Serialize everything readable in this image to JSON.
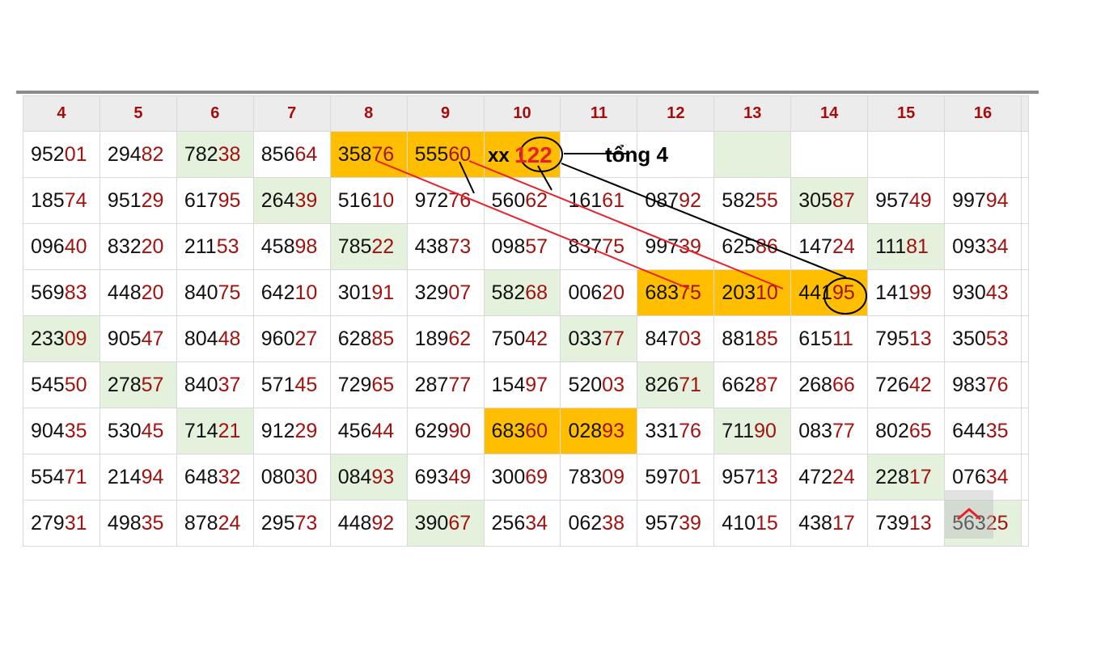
{
  "headers": [
    "4",
    "5",
    "6",
    "7",
    "8",
    "9",
    "10",
    "11",
    "12",
    "13",
    "14",
    "15",
    "16"
  ],
  "rows": [
    [
      {
        "v": "95201"
      },
      {
        "v": "29482"
      },
      {
        "v": "78238",
        "h": "g"
      },
      {
        "v": "85664"
      },
      {
        "v": "35876",
        "h": "o"
      },
      {
        "v": "55560",
        "h": "o"
      },
      {
        "v": "",
        "h": "o"
      },
      {
        "v": ""
      },
      {
        "v": ""
      },
      {
        "v": "",
        "h": "g"
      },
      {
        "v": ""
      },
      {
        "v": ""
      },
      {
        "v": ""
      }
    ],
    [
      {
        "v": "18574"
      },
      {
        "v": "95129"
      },
      {
        "v": "61795"
      },
      {
        "v": "26439",
        "h": "g"
      },
      {
        "v": "51610"
      },
      {
        "v": "97276"
      },
      {
        "v": "56062"
      },
      {
        "v": "16161"
      },
      {
        "v": "08792"
      },
      {
        "v": "58255"
      },
      {
        "v": "30587",
        "h": "g"
      },
      {
        "v": "95749"
      },
      {
        "v": "99794"
      }
    ],
    [
      {
        "v": "09640"
      },
      {
        "v": "83220"
      },
      {
        "v": "21153"
      },
      {
        "v": "45898"
      },
      {
        "v": "78522",
        "h": "g"
      },
      {
        "v": "43873"
      },
      {
        "v": "09857"
      },
      {
        "v": "83775"
      },
      {
        "v": "99739"
      },
      {
        "v": "62586"
      },
      {
        "v": "14724"
      },
      {
        "v": "11181",
        "h": "g"
      },
      {
        "v": "09334"
      }
    ],
    [
      {
        "v": "56983"
      },
      {
        "v": "44820"
      },
      {
        "v": "84075"
      },
      {
        "v": "64210"
      },
      {
        "v": "30191"
      },
      {
        "v": "32907"
      },
      {
        "v": "58268",
        "h": "g"
      },
      {
        "v": "00620"
      },
      {
        "v": "68375",
        "h": "o"
      },
      {
        "v": "20310",
        "h": "o"
      },
      {
        "v": "44195",
        "h": "o"
      },
      {
        "v": "14199"
      },
      {
        "v": "93043"
      }
    ],
    [
      {
        "v": "23309",
        "h": "g"
      },
      {
        "v": "90547"
      },
      {
        "v": "80448"
      },
      {
        "v": "96027"
      },
      {
        "v": "62885"
      },
      {
        "v": "18962"
      },
      {
        "v": "75042"
      },
      {
        "v": "03377",
        "h": "g"
      },
      {
        "v": "84703"
      },
      {
        "v": "88185"
      },
      {
        "v": "61511"
      },
      {
        "v": "79513"
      },
      {
        "v": "35053"
      }
    ],
    [
      {
        "v": "54550"
      },
      {
        "v": "27857",
        "h": "g"
      },
      {
        "v": "84037"
      },
      {
        "v": "57145"
      },
      {
        "v": "72965"
      },
      {
        "v": "28777"
      },
      {
        "v": "15497"
      },
      {
        "v": "52003"
      },
      {
        "v": "82671",
        "h": "g"
      },
      {
        "v": "66287"
      },
      {
        "v": "26866"
      },
      {
        "v": "72642"
      },
      {
        "v": "98376"
      }
    ],
    [
      {
        "v": "90435"
      },
      {
        "v": "53045"
      },
      {
        "v": "71421",
        "h": "g"
      },
      {
        "v": "91229"
      },
      {
        "v": "45644"
      },
      {
        "v": "62990"
      },
      {
        "v": "68360",
        "h": "o"
      },
      {
        "v": "02893",
        "h": "o"
      },
      {
        "v": "33176"
      },
      {
        "v": "71190",
        "h": "g"
      },
      {
        "v": "08377"
      },
      {
        "v": "80265"
      },
      {
        "v": "64435"
      }
    ],
    [
      {
        "v": "55471"
      },
      {
        "v": "21494"
      },
      {
        "v": "64832"
      },
      {
        "v": "08030"
      },
      {
        "v": "08493",
        "h": "g"
      },
      {
        "v": "69349"
      },
      {
        "v": "30069"
      },
      {
        "v": "78309"
      },
      {
        "v": "59701"
      },
      {
        "v": "95713"
      },
      {
        "v": "47224"
      },
      {
        "v": "22817",
        "h": "g"
      },
      {
        "v": "07634"
      }
    ],
    [
      {
        "v": "27931"
      },
      {
        "v": "49835"
      },
      {
        "v": "87824"
      },
      {
        "v": "29573"
      },
      {
        "v": "44892"
      },
      {
        "v": "39067",
        "h": "g"
      },
      {
        "v": "25634"
      },
      {
        "v": "06238"
      },
      {
        "v": "95739"
      },
      {
        "v": "41015"
      },
      {
        "v": "43817"
      },
      {
        "v": "73913"
      },
      {
        "v": "56325",
        "h": "g"
      }
    ]
  ],
  "annotation": {
    "prefix": "xx",
    "digits": "122",
    "note": "tổng 4",
    "colors": {
      "red": "#e8202a",
      "black": "#000000"
    }
  },
  "colors": {
    "header_text": "#a50d0d",
    "tail_digits": "#a3120f",
    "highlight_orange": "#ffbe00",
    "highlight_green": "#e3f1dd",
    "scroll_chevron": "#e8202a"
  },
  "icons": {
    "scroll_top": "chevron-up-icon"
  }
}
